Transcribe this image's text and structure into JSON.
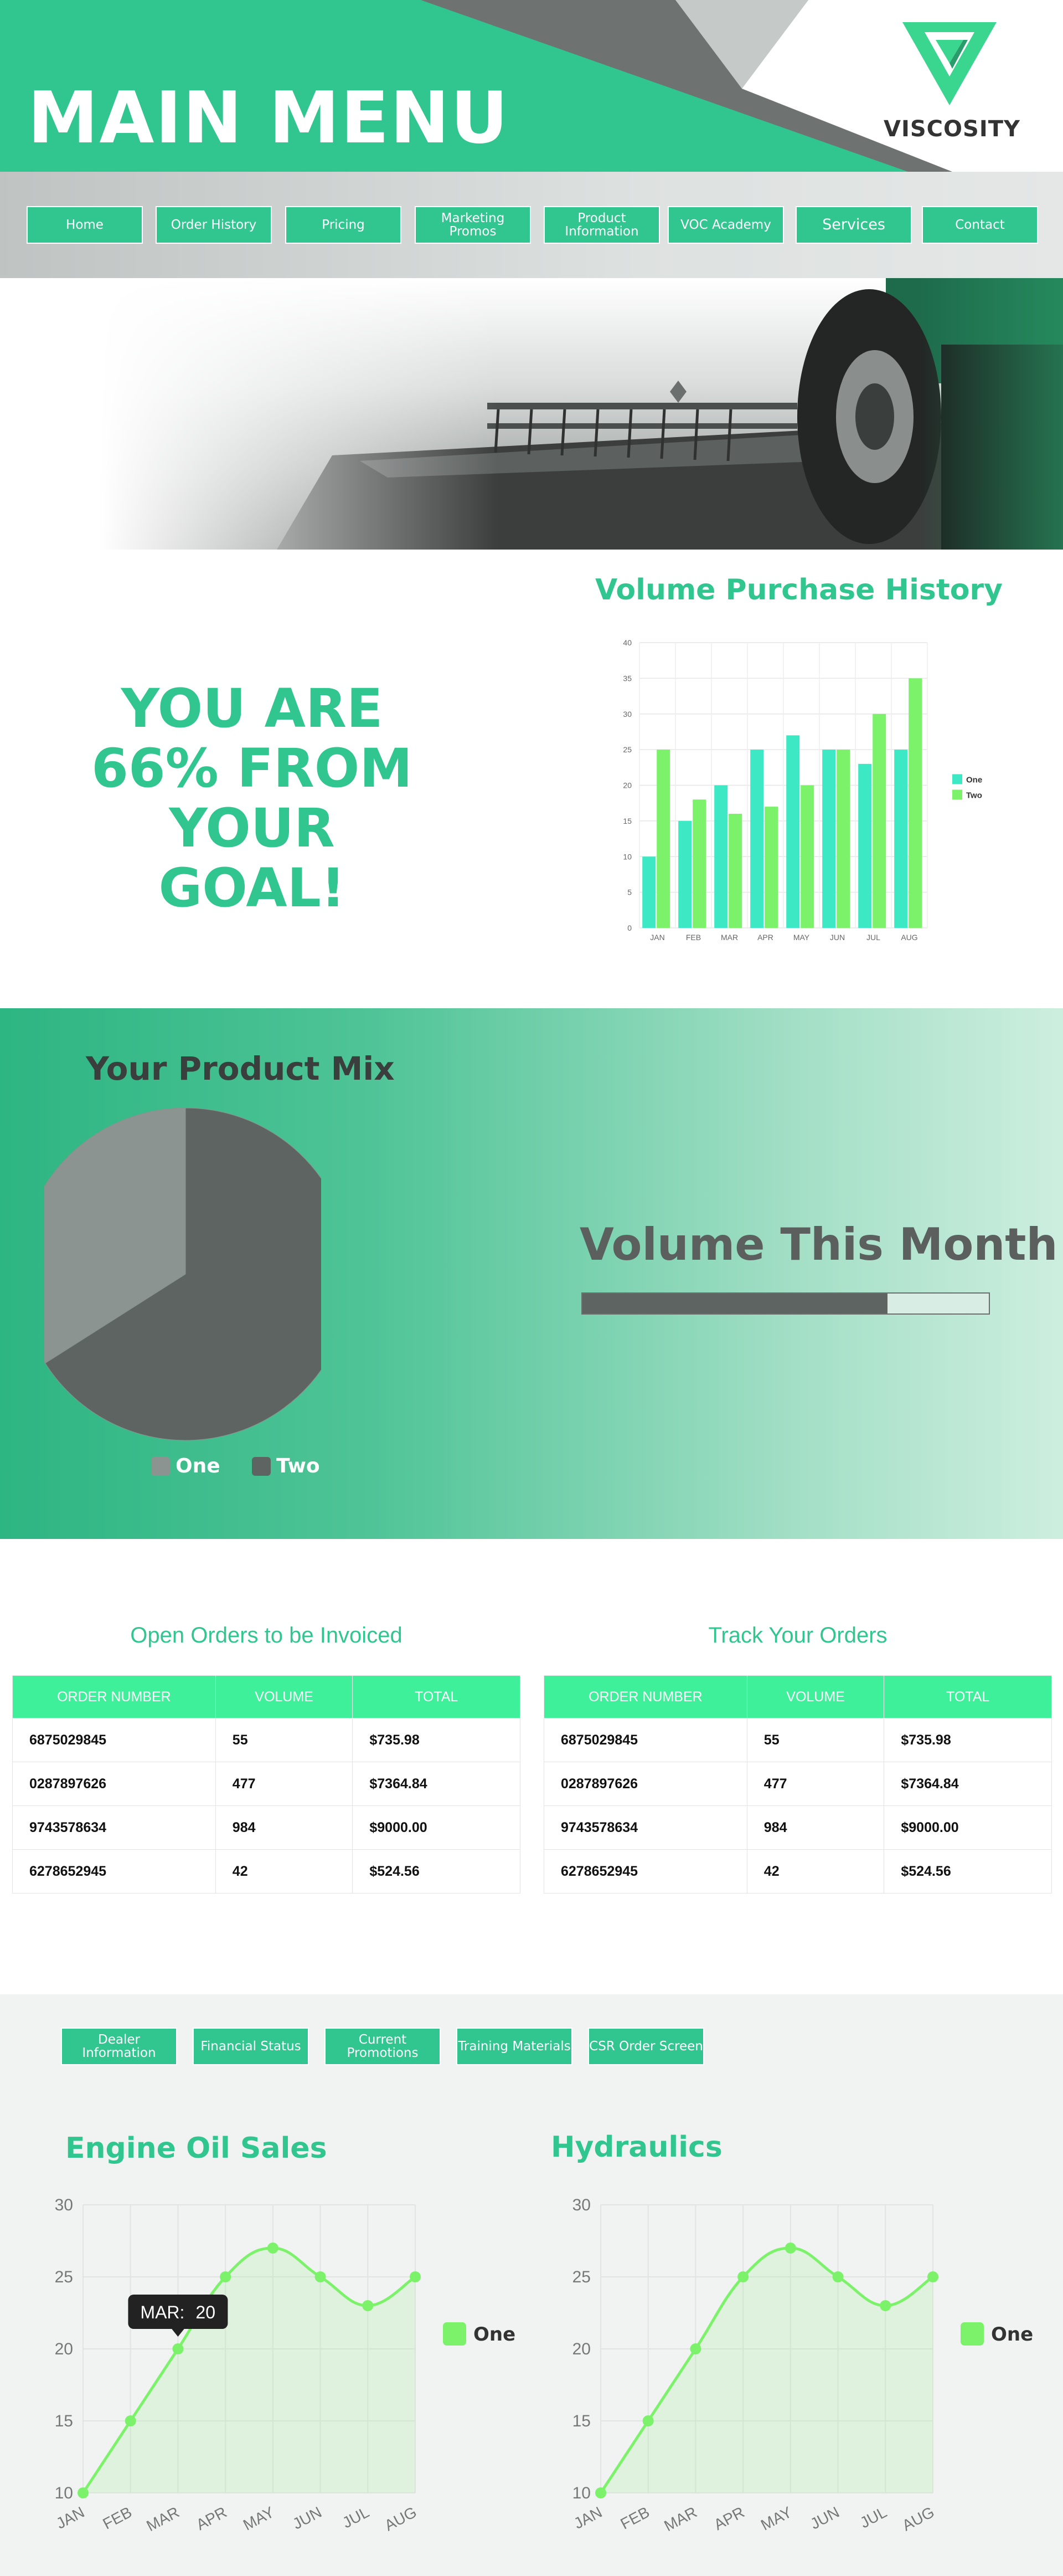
{
  "header": {
    "title": "MAIN MENU",
    "brand": "VISCOSITY",
    "logo_icon": "viscosity-v-logo"
  },
  "nav": [
    {
      "label": "Home"
    },
    {
      "label": "Order History"
    },
    {
      "label": "Pricing"
    },
    {
      "label": "Marketing Promos"
    },
    {
      "label": "Product Information"
    },
    {
      "label": "VOC Academy"
    },
    {
      "label": "Services"
    },
    {
      "label": "Contact"
    }
  ],
  "goal": {
    "line1": "YOU ARE",
    "line2": "66% FROM",
    "line3": "YOUR GOAL!"
  },
  "volume_history": {
    "title": "Volume Purchase History"
  },
  "product_mix": {
    "title": "Your Product Mix"
  },
  "volume_month": {
    "title": "Volume This Month",
    "progress": 0.75
  },
  "open_orders": {
    "title": "Open Orders to be Invoiced",
    "headers": [
      "ORDER NUMBER",
      "VOLUME",
      "TOTAL"
    ],
    "rows": [
      [
        "6875029845",
        "55",
        "$735.98"
      ],
      [
        "0287897626",
        "477",
        "$7364.84"
      ],
      [
        "9743578634",
        "984",
        "$9000.00"
      ],
      [
        "6278652945",
        "42",
        "$524.56"
      ]
    ]
  },
  "track_orders": {
    "title": "Track Your Orders",
    "headers": [
      "ORDER NUMBER",
      "VOLUME",
      "TOTAL"
    ],
    "rows": [
      [
        "6875029845",
        "55",
        "$735.98"
      ],
      [
        "0287897626",
        "477",
        "$7364.84"
      ],
      [
        "9743578634",
        "984",
        "$9000.00"
      ],
      [
        "6278652945",
        "42",
        "$524.56"
      ]
    ]
  },
  "sub_nav": [
    {
      "label": "Dealer Information"
    },
    {
      "label": "Financial Status"
    },
    {
      "label": "Current Promotions"
    },
    {
      "label": "Training Materials"
    },
    {
      "label": "CSR Order Screen"
    }
  ],
  "engine_oil": {
    "title": "Engine Oil Sales",
    "tooltip_label": "MAR:",
    "tooltip_value": "20"
  },
  "hydraulics": {
    "title": "Hydraulics"
  },
  "colors": {
    "accent": "#31c58f",
    "bright": "#3ef09a",
    "cyan": "#3de8c4",
    "lime": "#7bf26a",
    "dark_gray": "#5e6462",
    "light_gray": "#8c9491"
  },
  "chart_data": [
    {
      "type": "bar",
      "title": "Volume Purchase History",
      "categories": [
        "JAN",
        "FEB",
        "MAR",
        "APR",
        "MAY",
        "JUN",
        "JUL",
        "AUG"
      ],
      "series": [
        {
          "name": "One",
          "values": [
            10,
            15,
            20,
            25,
            27,
            25,
            23,
            25
          ]
        },
        {
          "name": "Two",
          "values": [
            25,
            18,
            16,
            17,
            20,
            25,
            30,
            35
          ]
        }
      ],
      "ylim": [
        0,
        40
      ],
      "yticks": [
        0,
        5,
        10,
        15,
        20,
        25,
        30,
        35,
        40
      ],
      "legend": "right",
      "grid": true
    },
    {
      "type": "pie",
      "title": "Your Product Mix",
      "categories": [
        "One",
        "Two"
      ],
      "values": [
        34,
        66
      ],
      "legend": "bottom"
    },
    {
      "type": "line",
      "title": "Engine Oil Sales",
      "x": [
        "JAN",
        "FEB",
        "MAR",
        "APR",
        "MAY",
        "JUN",
        "JUL",
        "AUG"
      ],
      "series": [
        {
          "name": "One",
          "values": [
            10,
            15,
            20,
            25,
            27,
            25,
            23,
            25
          ]
        }
      ],
      "ylim": [
        10,
        30
      ],
      "yticks": [
        10,
        15,
        20,
        25,
        30
      ],
      "legend": "right",
      "grid": true
    },
    {
      "type": "line",
      "title": "Hydraulics",
      "x": [
        "JAN",
        "FEB",
        "MAR",
        "APR",
        "MAY",
        "JUN",
        "JUL",
        "AUG"
      ],
      "series": [
        {
          "name": "One",
          "values": [
            10,
            15,
            20,
            25,
            27,
            25,
            23,
            25
          ]
        }
      ],
      "ylim": [
        10,
        30
      ],
      "yticks": [
        10,
        15,
        20,
        25,
        30
      ],
      "legend": "right",
      "grid": true
    }
  ]
}
